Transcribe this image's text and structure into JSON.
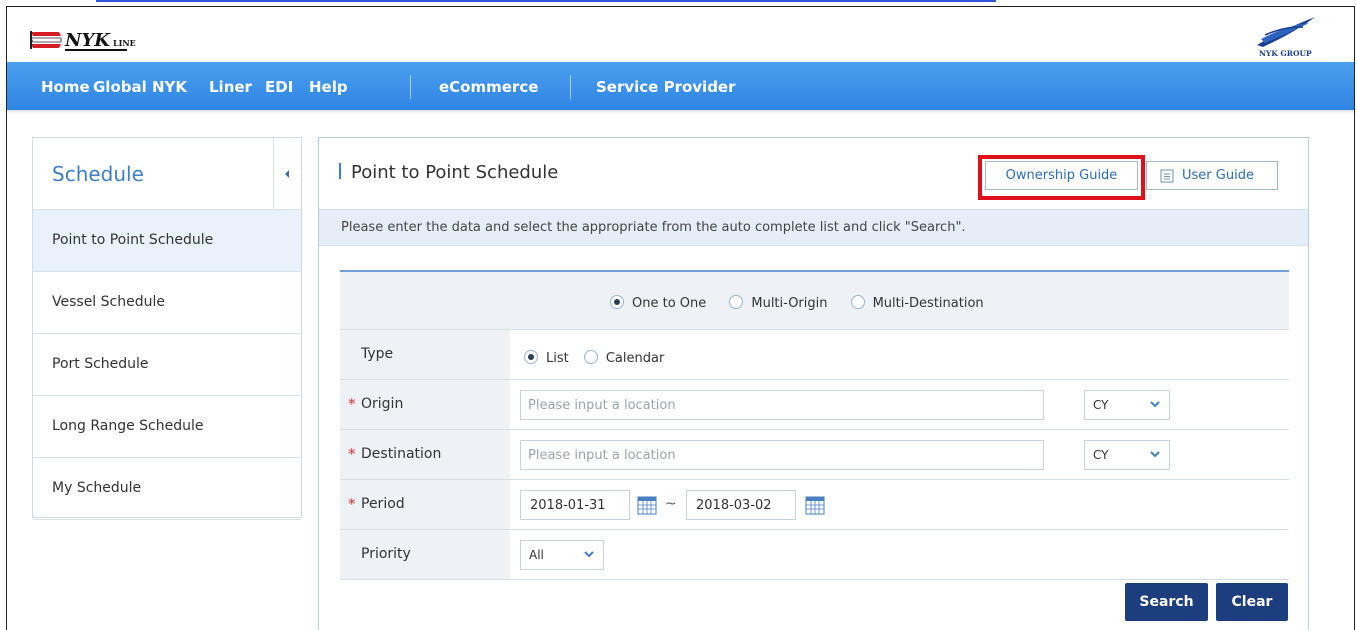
{
  "header": {
    "logo_text": "NYK LINE",
    "group_logo_text": "NYK GROUP"
  },
  "nav": {
    "items": [
      "Home",
      "Global NYK",
      "Liner",
      "EDI",
      "Help",
      "eCommerce",
      "Service Provider"
    ]
  },
  "sidebar": {
    "title": "Schedule",
    "items": [
      {
        "label": "Point to Point Schedule",
        "active": true
      },
      {
        "label": "Vessel Schedule",
        "active": false
      },
      {
        "label": "Port Schedule",
        "active": false
      },
      {
        "label": "Long Range Schedule",
        "active": false
      },
      {
        "label": "My Schedule",
        "active": false
      }
    ]
  },
  "main": {
    "title": "Point to Point Schedule",
    "ownership_guide_label": "Ownership Guide",
    "user_guide_label": "User Guide",
    "instruction": "Please enter the data and select the appropriate from the auto complete list and click \"Search\".",
    "mode_options": [
      "One to One",
      "Multi-Origin",
      "Multi-Destination"
    ],
    "mode_selected": "One to One",
    "type": {
      "label": "Type",
      "options": [
        "List",
        "Calendar"
      ],
      "selected": "List"
    },
    "origin": {
      "label": "Origin",
      "placeholder": "Please input a location",
      "value": "",
      "mode": "CY"
    },
    "destination": {
      "label": "Destination",
      "placeholder": "Please input a location",
      "value": "",
      "mode": "CY"
    },
    "period": {
      "label": "Period",
      "from": "2018-01-31",
      "to": "2018-03-02",
      "separator": "~"
    },
    "priority": {
      "label": "Priority",
      "value": "All"
    },
    "required_mark": "*",
    "search_label": "Search",
    "clear_label": "Clear"
  },
  "colors": {
    "nav_blue": "#3a91e8",
    "accent_blue": "#3f7fc6",
    "button_navy": "#1d3e7e",
    "highlight_red": "#e0101b",
    "required_red": "#e03030"
  },
  "icons": [
    "collapse-arrow-icon",
    "document-icon",
    "calendar-icon",
    "chevron-down-icon",
    "radio-icon"
  ]
}
